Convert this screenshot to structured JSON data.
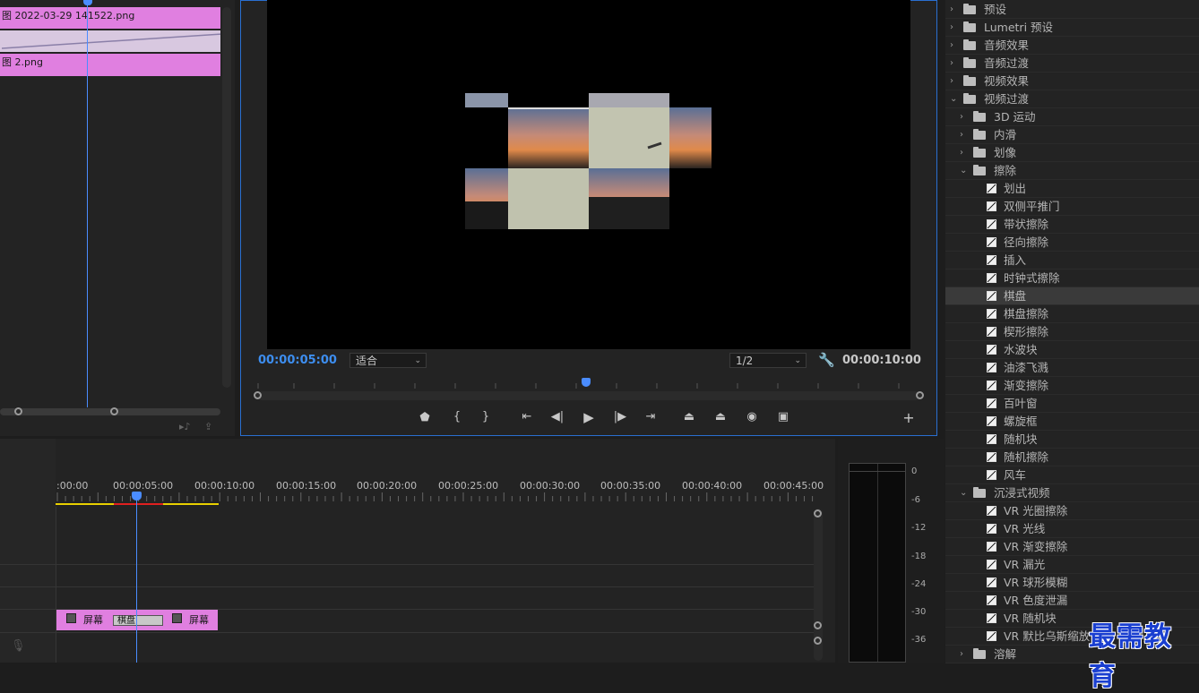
{
  "source": {
    "clip1_label": "图 2022-03-29  141522.png",
    "clip2_label": "图 2.png"
  },
  "monitor": {
    "current_time": "00:00:05:00",
    "duration": "00:00:10:00",
    "fit_value": "适合",
    "resolution_value": "1/2",
    "controls": [
      "marker-icon",
      "mark-in-icon",
      "mark-out-icon",
      "go-to-in-icon",
      "step-back-icon",
      "play-icon",
      "step-forward-icon",
      "go-to-out-icon",
      "lift-icon",
      "extract-icon",
      "camera-icon",
      "compare-icon",
      "add-icon"
    ]
  },
  "timeline": {
    "time_labels": [
      ":00:00",
      "00:00:05:00",
      "00:00:10:00",
      "00:00:15:00",
      "00:00:20:00",
      "00:00:25:00",
      "00:00:30:00",
      "00:00:35:00",
      "00:00:40:00",
      "00:00:45:00"
    ],
    "clip_a": "屏幕",
    "clip_b": "屏幕",
    "transition": "棋盘"
  },
  "meter": {
    "db_labels": [
      "0",
      "-6",
      "-12",
      "-18",
      "-24",
      "-30",
      "-36"
    ]
  },
  "effects": {
    "items": [
      {
        "label": "预设",
        "level": 0,
        "type": "folder-special",
        "expanded": false
      },
      {
        "label": "Lumetri 预设",
        "level": 0,
        "type": "folder-special",
        "expanded": false
      },
      {
        "label": "音频效果",
        "level": 0,
        "type": "folder",
        "expanded": false
      },
      {
        "label": "音频过渡",
        "level": 0,
        "type": "folder",
        "expanded": false
      },
      {
        "label": "视频效果",
        "level": 0,
        "type": "folder",
        "expanded": false
      },
      {
        "label": "视频过渡",
        "level": 0,
        "type": "folder",
        "expanded": true
      },
      {
        "label": "3D 运动",
        "level": 1,
        "type": "folder",
        "expanded": false
      },
      {
        "label": "内滑",
        "level": 1,
        "type": "folder",
        "expanded": false
      },
      {
        "label": "划像",
        "level": 1,
        "type": "folder",
        "expanded": false
      },
      {
        "label": "擦除",
        "level": 1,
        "type": "folder",
        "expanded": true
      },
      {
        "label": "划出",
        "level": 2,
        "type": "effect"
      },
      {
        "label": "双侧平推门",
        "level": 2,
        "type": "effect"
      },
      {
        "label": "带状擦除",
        "level": 2,
        "type": "effect"
      },
      {
        "label": "径向擦除",
        "level": 2,
        "type": "effect"
      },
      {
        "label": "插入",
        "level": 2,
        "type": "effect"
      },
      {
        "label": "时钟式擦除",
        "level": 2,
        "type": "effect"
      },
      {
        "label": "棋盘",
        "level": 2,
        "type": "effect",
        "selected": true
      },
      {
        "label": "棋盘擦除",
        "level": 2,
        "type": "effect"
      },
      {
        "label": "楔形擦除",
        "level": 2,
        "type": "effect"
      },
      {
        "label": "水波块",
        "level": 2,
        "type": "effect"
      },
      {
        "label": "油漆飞溅",
        "level": 2,
        "type": "effect"
      },
      {
        "label": "渐变擦除",
        "level": 2,
        "type": "effect"
      },
      {
        "label": "百叶窗",
        "level": 2,
        "type": "effect"
      },
      {
        "label": "螺旋框",
        "level": 2,
        "type": "effect"
      },
      {
        "label": "随机块",
        "level": 2,
        "type": "effect"
      },
      {
        "label": "随机擦除",
        "level": 2,
        "type": "effect"
      },
      {
        "label": "风车",
        "level": 2,
        "type": "effect"
      },
      {
        "label": "沉浸式视频",
        "level": 1,
        "type": "folder",
        "expanded": true
      },
      {
        "label": "VR 光圈擦除",
        "level": 2,
        "type": "effect"
      },
      {
        "label": "VR 光线",
        "level": 2,
        "type": "effect"
      },
      {
        "label": "VR 渐变擦除",
        "level": 2,
        "type": "effect"
      },
      {
        "label": "VR 漏光",
        "level": 2,
        "type": "effect"
      },
      {
        "label": "VR 球形模糊",
        "level": 2,
        "type": "effect"
      },
      {
        "label": "VR 色度泄漏",
        "level": 2,
        "type": "effect"
      },
      {
        "label": "VR 随机块",
        "level": 2,
        "type": "effect"
      },
      {
        "label": "VR 默比乌斯缩放",
        "level": 2,
        "type": "effect"
      },
      {
        "label": "溶解",
        "level": 1,
        "type": "folder",
        "expanded": false
      }
    ]
  },
  "watermark": "最需教育"
}
